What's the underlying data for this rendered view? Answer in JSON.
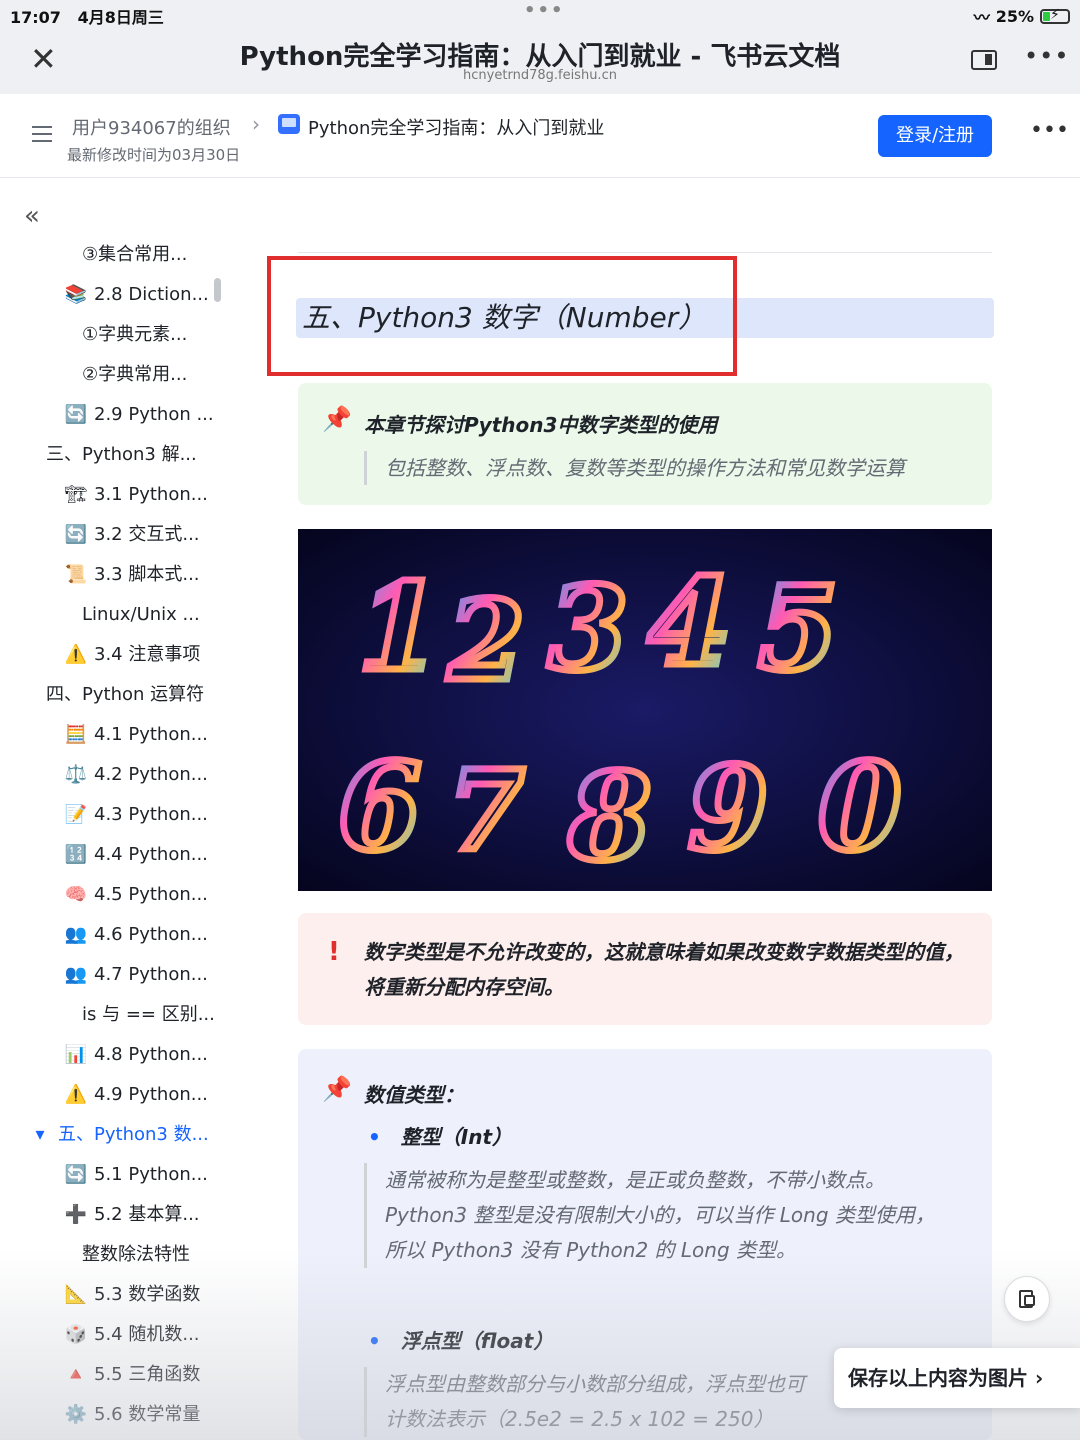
{
  "status": {
    "time": "17:07",
    "date": "4月8日周三",
    "dots": "•••",
    "battery": "25%"
  },
  "browser": {
    "title": "Python完全学习指南：从入门到就业 - 飞书云文档",
    "url": "hcnyetrnd78g.feishu.cn"
  },
  "docbar": {
    "org": "用户934067的组织",
    "doc_title": "Python完全学习指南：从入门到就业",
    "modified": "最新修改时间为03月30日",
    "login": "登录/注册"
  },
  "toc": [
    {
      "icon": "",
      "label": "③集合常用...",
      "indent": 82
    },
    {
      "icon": "📚",
      "label": "2.8 Diction...",
      "indent": 64
    },
    {
      "icon": "",
      "label": "①字典元素...",
      "indent": 82
    },
    {
      "icon": "",
      "label": "②字典常用...",
      "indent": 82
    },
    {
      "icon": "🔄",
      "label": "2.9 Python ...",
      "indent": 64
    },
    {
      "icon": "",
      "label": "三、Python3 解...",
      "indent": 46
    },
    {
      "icon": "🏗",
      "label": "3.1 Python...",
      "indent": 64
    },
    {
      "icon": "🔄",
      "label": "3.2 交互式...",
      "indent": 64
    },
    {
      "icon": "📜",
      "label": "3.3 脚本式...",
      "indent": 64
    },
    {
      "icon": "",
      "label": "Linux/Unix ...",
      "indent": 82
    },
    {
      "icon": "⚠️",
      "label": "3.4 注意事项",
      "indent": 64
    },
    {
      "icon": "",
      "label": "四、Python 运算符",
      "indent": 46
    },
    {
      "icon": "🧮",
      "label": "4.1 Python...",
      "indent": 64
    },
    {
      "icon": "⚖️",
      "label": "4.2 Python...",
      "indent": 64
    },
    {
      "icon": "📝",
      "label": "4.3 Python...",
      "indent": 64
    },
    {
      "icon": "🔢",
      "label": "4.4 Python...",
      "indent": 64
    },
    {
      "icon": "🧠",
      "label": "4.5 Python...",
      "indent": 64
    },
    {
      "icon": "👥",
      "label": "4.6 Python...",
      "indent": 64
    },
    {
      "icon": "👥",
      "label": "4.7 Python...",
      "indent": 64
    },
    {
      "icon": "",
      "label": "is 与 == 区别...",
      "indent": 82
    },
    {
      "icon": "📊",
      "label": "4.8 Python...",
      "indent": 64
    },
    {
      "icon": "⚠️",
      "label": "4.9 Python...",
      "indent": 64
    },
    {
      "icon": "▾",
      "label": "五、Python3 数...",
      "indent": 28,
      "active": true
    },
    {
      "icon": "🔄",
      "label": "5.1 Python...",
      "indent": 64
    },
    {
      "icon": "➕",
      "label": "5.2 基本算...",
      "indent": 64
    },
    {
      "icon": "",
      "label": "整数除法特性",
      "indent": 82
    },
    {
      "icon": "📐",
      "label": "5.3 数学函数",
      "indent": 64
    },
    {
      "icon": "🎲",
      "label": "5.4 随机数...",
      "indent": 64
    },
    {
      "icon": "🔺",
      "label": "5.5 三角函数",
      "indent": 64
    },
    {
      "icon": "⚙️",
      "label": "5.6 数学常量",
      "indent": 64
    }
  ],
  "content": {
    "heading": "五、Python3 数字（Number）",
    "intro_title": "本章节探讨Python3中数字类型的使用",
    "intro_quote": "包括整数、浮点数、复数等类型的操作方法和常见数学运算",
    "warning": "数字类型是不允许改变的，这就意味着如果改变数字数据类型的值，将重新分配内存空间。",
    "types_title": "数值类型：",
    "int_title": "整型（Int）",
    "int_lines": [
      "通常被称为是整型或整数，是正或负整数，不带小数点。",
      "Python3 整型是没有限制大小的，可以当作 Long 类型使用，",
      "所以 Python3 没有 Python2 的 Long 类型。"
    ],
    "float_title": "浮点型（float）",
    "float_lines": [
      "浮点型由整数部分与小数部分组成，浮点型也可",
      "计数法表示（2.5e2 = 2.5 x 102 = 250）"
    ],
    "save_image": "保存以上内容为图片 ›",
    "hero_digits": [
      "1",
      "2",
      "3",
      "4",
      "5",
      "6",
      "7",
      "8",
      "9",
      "0"
    ]
  },
  "colors": {
    "accent": "#1664ff",
    "heading_bg": "#dde6fb",
    "highlight_box": "#e02d2d"
  }
}
